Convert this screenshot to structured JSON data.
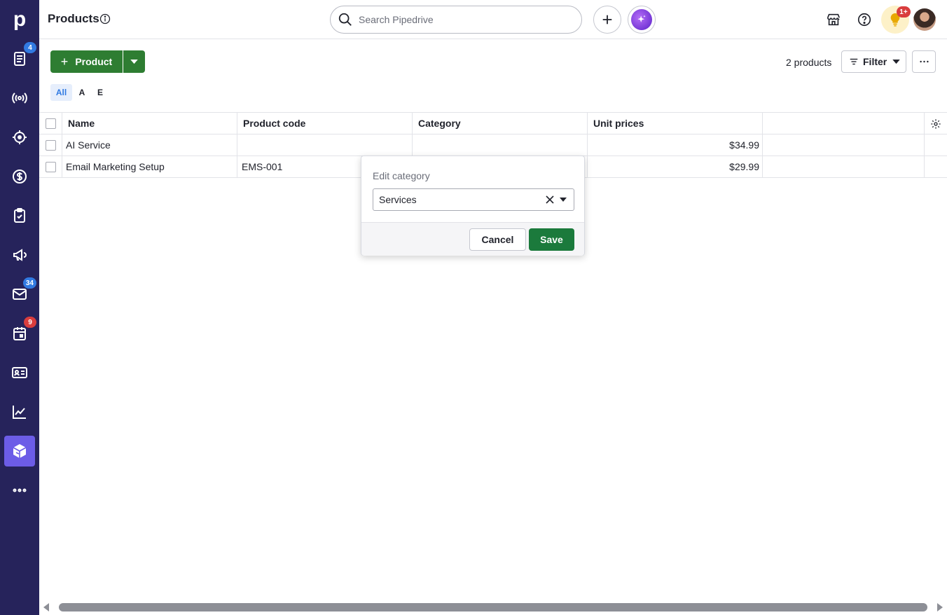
{
  "app": {
    "logo_letter": "p"
  },
  "sidebar": {
    "items": [
      {
        "name": "leads",
        "badge": "4"
      },
      {
        "name": "campaigns-radio",
        "badge": ""
      },
      {
        "name": "projects-target",
        "badge": ""
      },
      {
        "name": "deals",
        "badge": ""
      },
      {
        "name": "tasks",
        "badge": ""
      },
      {
        "name": "campaigns",
        "badge": ""
      },
      {
        "name": "mail",
        "badge": "34"
      },
      {
        "name": "activities",
        "badge": "9"
      },
      {
        "name": "contacts",
        "badge": ""
      },
      {
        "name": "insights",
        "badge": ""
      },
      {
        "name": "products",
        "badge": ""
      },
      {
        "name": "more",
        "badge": ""
      }
    ],
    "badge_colors": {
      "leads": "#317ae2",
      "mail": "#317ae2",
      "activities": "#d93d3d"
    }
  },
  "header": {
    "title": "Products",
    "search_placeholder": "Search Pipedrive",
    "bulb_badge": "1+"
  },
  "toolbar": {
    "add_label": "Product",
    "count_text": "2 products",
    "filter_label": "Filter"
  },
  "letter_filters": [
    "All",
    "A",
    "E"
  ],
  "table": {
    "columns": [
      "Name",
      "Product code",
      "Category",
      "Unit prices"
    ],
    "rows": [
      {
        "name": "AI Service",
        "code": "",
        "category": "",
        "price": "$34.99"
      },
      {
        "name": "Email Marketing Setup",
        "code": "EMS-001",
        "category": "",
        "price": "$29.99"
      }
    ]
  },
  "popover": {
    "title": "Edit category",
    "selected_value": "Services",
    "cancel_label": "Cancel",
    "save_label": "Save"
  },
  "colors": {
    "sidebar_bg": "#26235b",
    "active_nav": "#6c5ce7",
    "primary_green": "#2e7d32",
    "save_green": "#1b7a3c"
  }
}
